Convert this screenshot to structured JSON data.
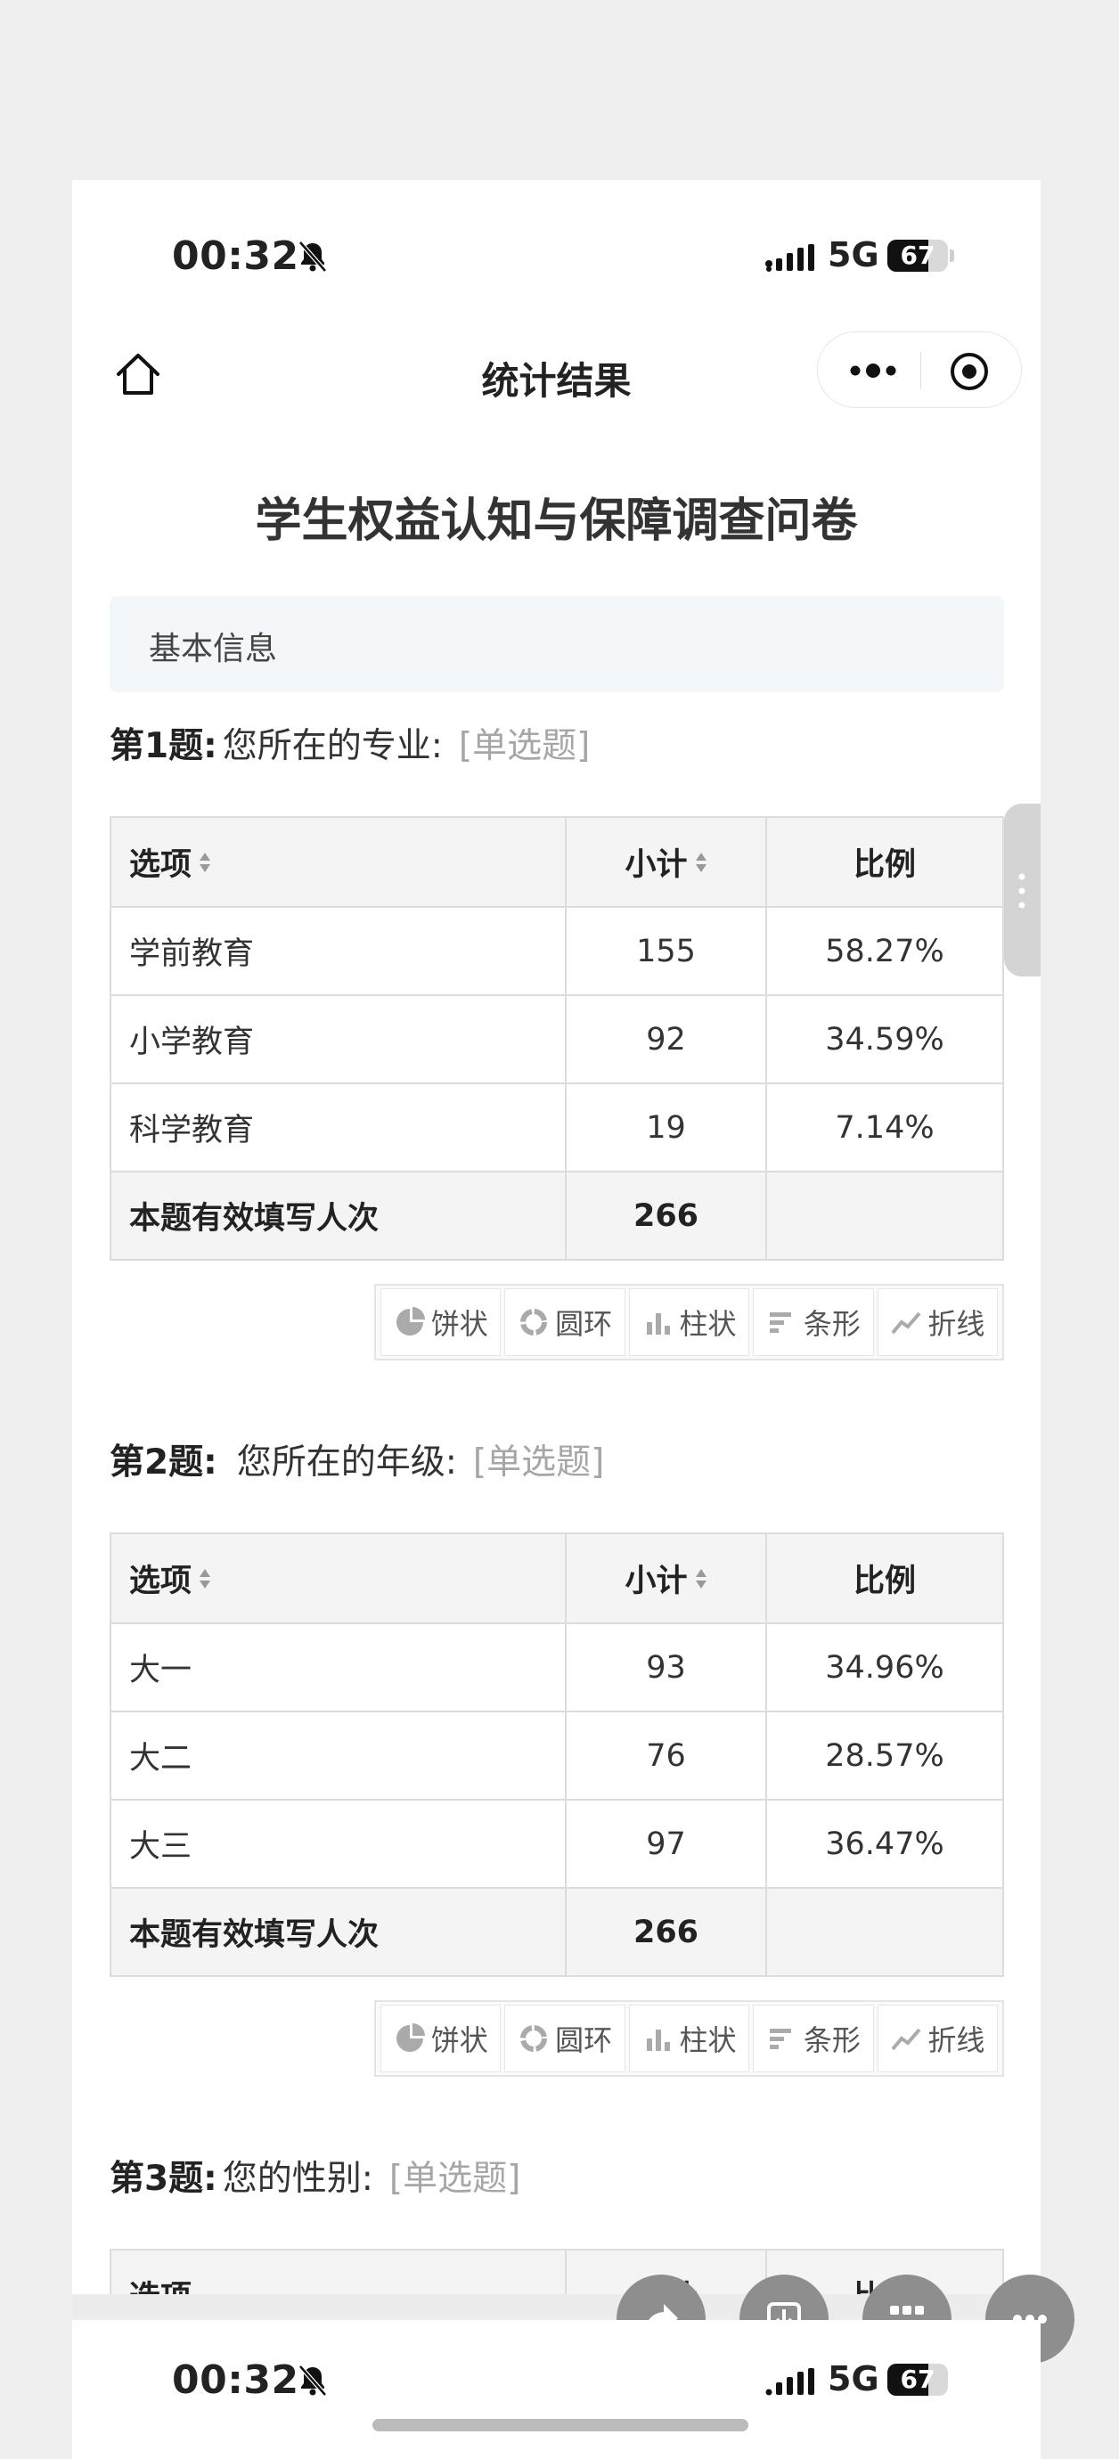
{
  "status_bar": {
    "time": "00:32",
    "network": "5G",
    "battery": "67",
    "battery_level": 0.67
  },
  "navbar": {
    "title": "统计结果"
  },
  "survey": {
    "title": "学生权益认知与保障调查问卷",
    "section": "基本信息"
  },
  "table_headers": {
    "option": "选项",
    "count": "小计",
    "ratio": "比例"
  },
  "questions": [
    {
      "number": "第1题:",
      "text": "您所在的专业:",
      "type": "[单选题]",
      "rows": [
        {
          "option": "学前教育",
          "count": "155",
          "ratio": "58.27%"
        },
        {
          "option": "小学教育",
          "count": "92",
          "ratio": "34.59%"
        },
        {
          "option": "科学教育",
          "count": "19",
          "ratio": "7.14%"
        }
      ],
      "total_label": "本题有效填写人次",
      "total": "266"
    },
    {
      "number": "第2题:",
      "text": "您所在的年级:",
      "type": "[单选题]",
      "rows": [
        {
          "option": "大一",
          "count": "93",
          "ratio": "34.96%"
        },
        {
          "option": "大二",
          "count": "76",
          "ratio": "28.57%"
        },
        {
          "option": "大三",
          "count": "97",
          "ratio": "36.47%"
        }
      ],
      "total_label": "本题有效填写人次",
      "total": "266"
    },
    {
      "number": "第3题:",
      "text": "您的性别:",
      "type": "[单选题]"
    }
  ],
  "chart_buttons": [
    "饼状",
    "圆环",
    "柱状",
    "条形",
    "折线"
  ],
  "status_bar_2": {
    "time": "00:32",
    "network": "5G",
    "battery": "67"
  },
  "icons": {
    "home": "home-icon",
    "more": "more-dots-icon",
    "close": "target-close-icon",
    "share": "share-icon",
    "download": "download-icon",
    "grid": "grid-icon",
    "menu": "more-icon"
  }
}
